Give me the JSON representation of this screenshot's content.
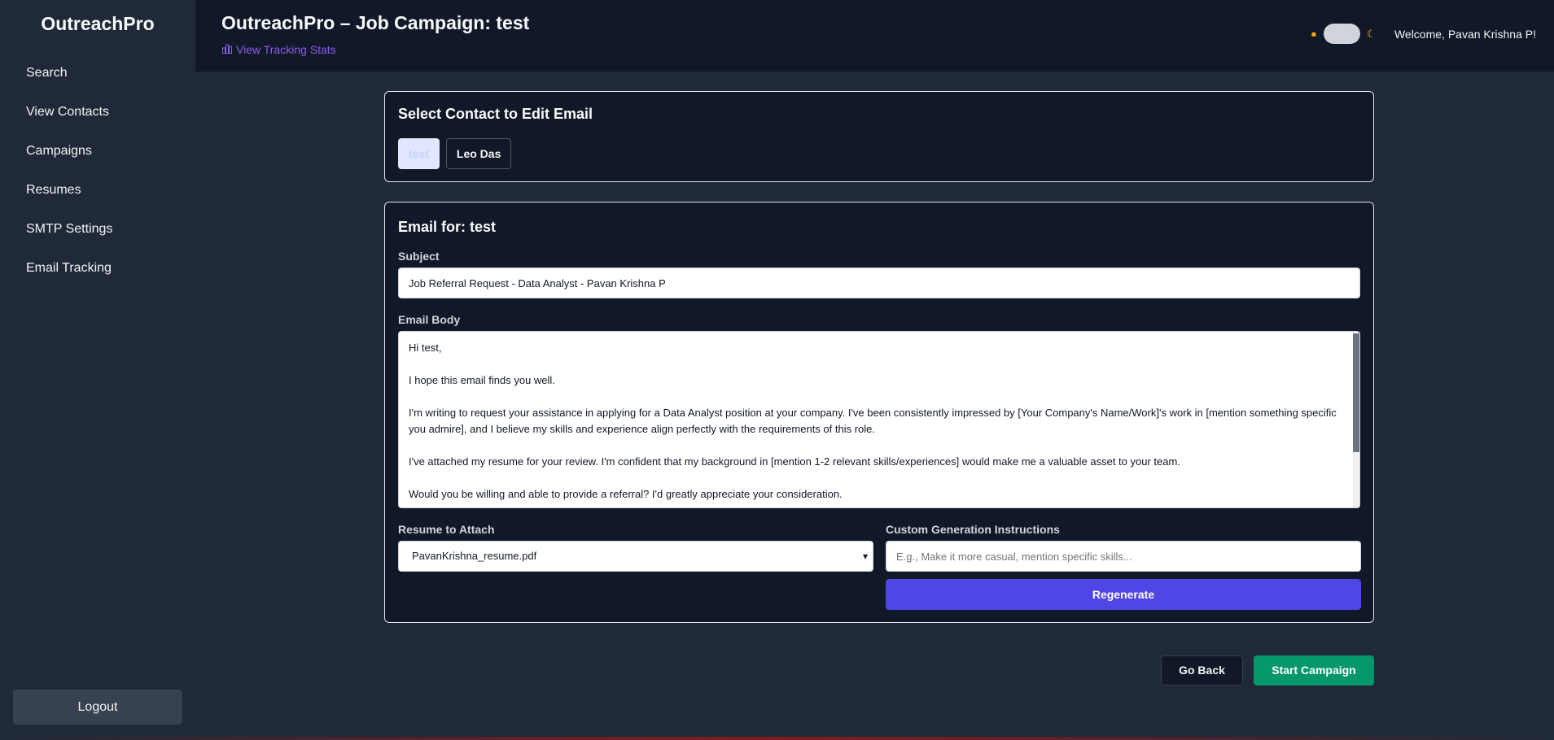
{
  "app": {
    "brand": "OutreachPro"
  },
  "sidebar": {
    "items": [
      {
        "label": "Search"
      },
      {
        "label": "View Contacts"
      },
      {
        "label": "Campaigns"
      },
      {
        "label": "Resumes"
      },
      {
        "label": "SMTP Settings"
      },
      {
        "label": "Email Tracking"
      }
    ],
    "logout_label": "Logout"
  },
  "header": {
    "title": "OutreachPro – Job Campaign: test",
    "tracking_link": "View Tracking Stats",
    "theme_icons": {
      "light": "sun-icon",
      "dark": "moon-icon"
    },
    "welcome": "Welcome, Pavan Krishna P!"
  },
  "contact_select": {
    "title": "Select Contact to Edit Email",
    "contacts": [
      {
        "label": "test",
        "active": true
      },
      {
        "label": "Leo Das",
        "active": false
      }
    ]
  },
  "email_editor": {
    "title": "Email for: test",
    "subject_label": "Subject",
    "subject_value": "Job Referral Request - Data Analyst - Pavan Krishna P",
    "body_label": "Email Body",
    "body_paragraphs": [
      "Hi test,",
      "I hope this email finds you well.",
      "I'm writing to request your assistance in applying for a Data Analyst position at your company. I've been consistently impressed by [Your Company's Name/Work]'s work in [mention something specific you admire], and I believe my skills and experience align perfectly with the requirements of this role.",
      "I've attached my resume for your review. I'm confident that my background in [mention 1-2 relevant skills/experiences] would make me a valuable asset to your team.",
      "Would you be willing and able to provide a referral?  I'd greatly appreciate your consideration."
    ],
    "resume_label": "Resume to Attach",
    "resume_selected": "PavanKrishna_resume.pdf",
    "instructions_label": "Custom Generation Instructions",
    "instructions_placeholder": "E.g., Make it more casual, mention specific skills...",
    "regenerate_label": "Regenerate"
  },
  "actions": {
    "go_back": "Go Back",
    "start_campaign": "Start Campaign"
  },
  "colors": {
    "accent": "#4f46e5",
    "success": "#059669",
    "link": "#8b5cf6",
    "background": "#1f2937",
    "panel": "#111827"
  }
}
